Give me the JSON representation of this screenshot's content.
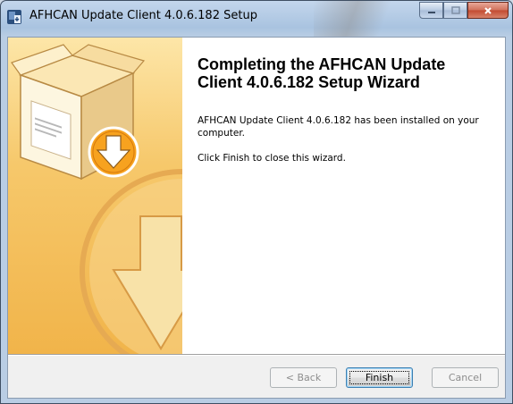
{
  "window": {
    "title": "AFHCAN Update Client 4.0.6.182 Setup",
    "icons": {
      "app": "installer-icon",
      "minimize": "minimize-icon",
      "maximize": "maximize-icon",
      "close": "close-icon"
    }
  },
  "wizard": {
    "heading": "Completing the AFHCAN Update Client 4.0.6.182 Setup Wizard",
    "installed_text": "AFHCAN Update Client 4.0.6.182 has been installed on your computer.",
    "finish_hint": "Click Finish to close this wizard.",
    "sidebar_image": "box-download-graphic"
  },
  "buttons": {
    "back": {
      "label": "< Back",
      "enabled": false
    },
    "finish": {
      "label": "Finish",
      "default": true
    },
    "cancel": {
      "label": "Cancel",
      "enabled": false
    }
  },
  "colors": {
    "sidebar_top": "#fde6a8",
    "sidebar_bottom": "#f1b44a",
    "titlebar": "#b9cde4",
    "close_button": "#c24a30"
  }
}
